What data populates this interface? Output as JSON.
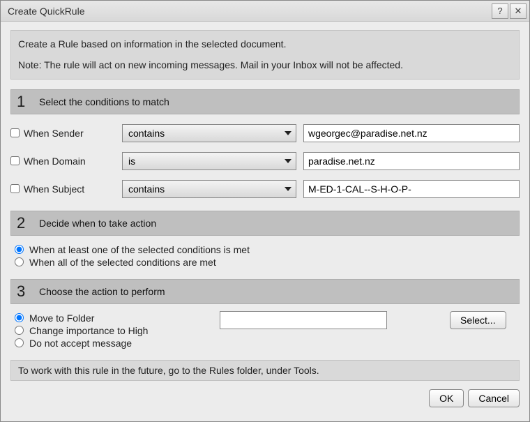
{
  "titlebar": {
    "title": "Create QuickRule",
    "help_glyph": "?",
    "close_glyph": "✕"
  },
  "intro": {
    "line1": "Create a Rule based on information in the selected document.",
    "line2": "Note: The rule will act on new incoming messages. Mail in your Inbox will not be affected."
  },
  "section1": {
    "num": "1",
    "title": "Select the conditions to match",
    "rows": [
      {
        "label": "When Sender",
        "op": "contains",
        "value": "wgeorgec@paradise.net.nz"
      },
      {
        "label": "When Domain",
        "op": "is",
        "value": "paradise.net.nz"
      },
      {
        "label": "When Subject",
        "op": "contains",
        "value": "M-ED-1-CAL--S-H-O-P-"
      }
    ]
  },
  "section2": {
    "num": "2",
    "title": "Decide when to take action",
    "option1": "When at least one of the selected conditions is met",
    "option2": "When all of the selected conditions are met"
  },
  "section3": {
    "num": "3",
    "title": "Choose the action to perform",
    "option1": "Move to Folder",
    "option2": "Change importance to High",
    "option3": "Do not accept message",
    "folder_value": "",
    "select_label": "Select..."
  },
  "footer_note": "To work with this rule in the future, go to the Rules folder, under Tools.",
  "buttons": {
    "ok": "OK",
    "cancel": "Cancel"
  }
}
